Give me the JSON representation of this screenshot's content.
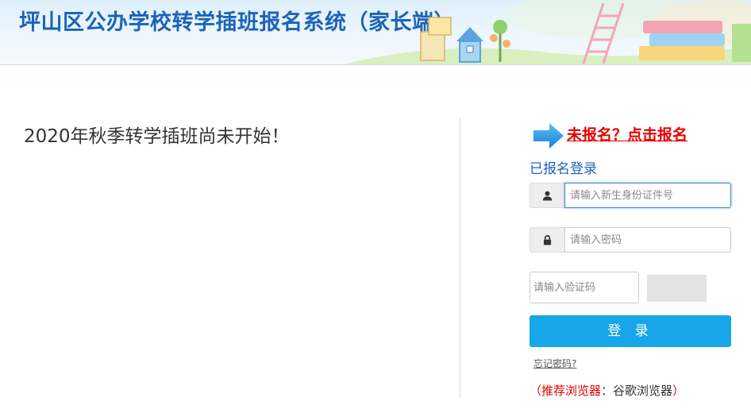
{
  "header": {
    "title": "坪山区公办学校转学插班报名系统（家长端）"
  },
  "main": {
    "notice": "2020年秋季转学插班尚未开始！"
  },
  "login": {
    "register_link": "未报名？点击报名",
    "heading": "已报名登录",
    "id_placeholder": "请输入新生身份证件号",
    "password_placeholder": "请输入密码",
    "captcha_placeholder": "请输入验证码",
    "login_button": "登 录",
    "forgot_password": "忘记密码?",
    "browser_tip": {
      "open_paren": "（",
      "label": "推荐浏览器",
      "colon": "：",
      "value": "谷歌浏览器",
      "close_paren": "）"
    }
  },
  "icons": {
    "arrow": "right-arrow-icon",
    "user": "user-icon",
    "lock": "lock-icon"
  },
  "colors": {
    "title_blue": "#1d63b8",
    "accent_red": "#e60000",
    "button_blue": "#17a7e8",
    "focus_blue": "#3b7fd9"
  }
}
